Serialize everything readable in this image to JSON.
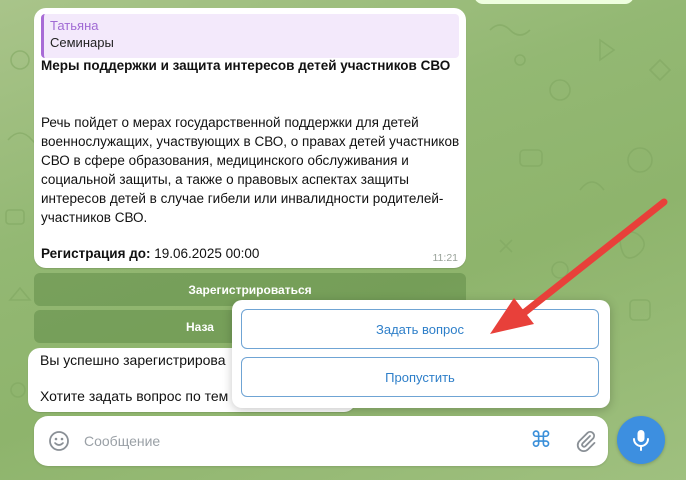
{
  "message": {
    "reply": {
      "author": "Татьяна",
      "text": "Семинары"
    },
    "title": "Меры поддержки и защита интересов детей участников СВО",
    "body": "Речь пойдет о мерах  государственной поддержки для детей военнослужащих, участвующих в СВО,  о правах детей участников СВО в сфере образования, медицинского обслуживания и социальной защиты, а также о правовых аспектах  защиты интересов детей в случае гибели или инвалидности родителей-участников СВО.",
    "registration_label": "Регистрация до:",
    "registration_value": " 19.06.2025 00:00",
    "time": "11:21"
  },
  "inline_buttons": {
    "register": "Зарегистрироваться",
    "second_partial": "Наза"
  },
  "bot_message": {
    "line1": "Вы успешно зарегистрирова",
    "line2": "Хотите задать вопрос по тем"
  },
  "keyboard": {
    "ask": "Задать вопрос",
    "skip": "Пропустить"
  },
  "input": {
    "placeholder": "Сообщение"
  },
  "icons": {
    "emoji": "smiley-icon",
    "commands": "command-icon",
    "attach": "paperclip-icon",
    "mic": "microphone-icon"
  },
  "colors": {
    "accent": "#3d8fe0",
    "reply_author": "#a06ad4",
    "arrow": "#e8403a"
  }
}
